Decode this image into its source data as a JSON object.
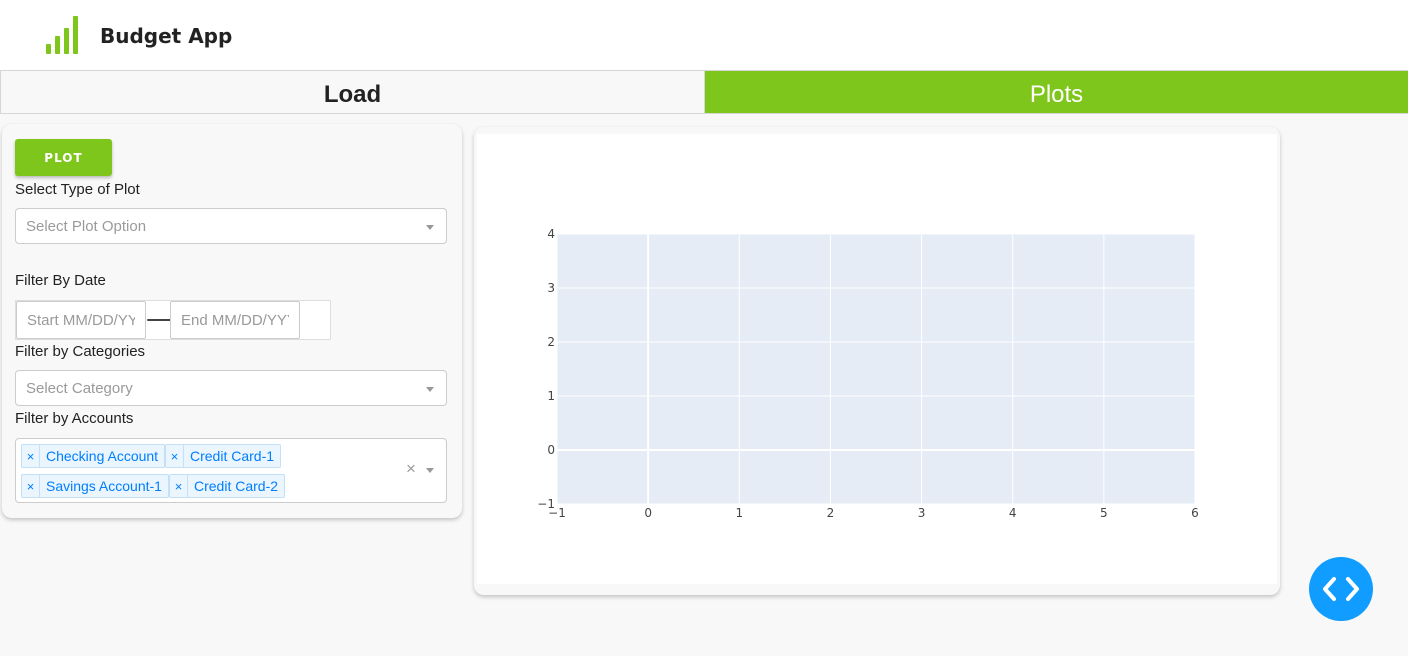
{
  "app": {
    "title": "Budget App",
    "logo_icon": "bar-chart-logo-icon",
    "accent_color": "#7fc61c"
  },
  "tabs": [
    {
      "label": "Load",
      "active": false
    },
    {
      "label": "Plots",
      "active": true
    }
  ],
  "controls": {
    "plot_button": "PLOT",
    "plot_type": {
      "label": "Select Type of Plot",
      "placeholder": "Select Plot Option"
    },
    "date_filter": {
      "label": "Filter By Date",
      "start_placeholder": "Start MM/DD/YYYY",
      "end_placeholder": "End MM/DD/YYYY"
    },
    "category_filter": {
      "label": "Filter by Categories",
      "placeholder": "Select Category"
    },
    "account_filter": {
      "label": "Filter by Accounts",
      "selected": [
        "Checking Account",
        "Credit Card-1",
        "Savings Account-1",
        "Credit Card-2"
      ]
    }
  },
  "chart_data": {
    "type": "scatter",
    "series": [],
    "xlim": [
      -1,
      6
    ],
    "ylim": [
      -1,
      4
    ],
    "x_ticks": [
      -1,
      0,
      1,
      2,
      3,
      4,
      5,
      6
    ],
    "y_ticks": [
      -1,
      0,
      1,
      2,
      3,
      4
    ],
    "x_tick_labels": [
      "−1",
      "0",
      "1",
      "2",
      "3",
      "4",
      "5",
      "6"
    ],
    "y_tick_labels": [
      "−1",
      "0",
      "1",
      "2",
      "3",
      "4"
    ],
    "title": "",
    "xlabel": "",
    "ylabel": "",
    "plot_bg": "#e5ecf6",
    "grid": true
  },
  "fab": {
    "icon": "code-brackets-icon",
    "color": "#119dff"
  }
}
